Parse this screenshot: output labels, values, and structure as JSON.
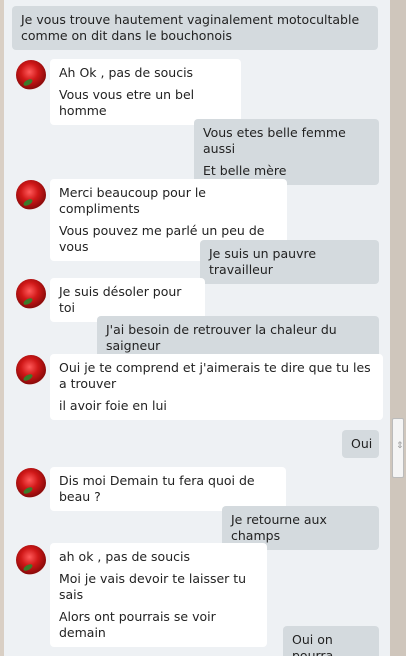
{
  "messages": [
    {
      "dir": "out",
      "lines": [
        "Je vous trouve hautement vaginalement motocultable",
        "comme on dit dans le bouchonois"
      ]
    },
    {
      "dir": "in",
      "lines": [
        "Ah Ok , pas de soucis",
        "Vous vous etre un bel homme"
      ]
    },
    {
      "dir": "out",
      "lines": [
        "Vous etes belle femme aussi",
        "Et belle mère"
      ]
    },
    {
      "dir": "in",
      "lines": [
        "Merci beaucoup pour le compliments",
        "Vous pouvez me parlé un peu de vous"
      ]
    },
    {
      "dir": "out",
      "lines": [
        "Je suis un pauvre travailleur"
      ]
    },
    {
      "dir": "in",
      "lines": [
        "Je suis désoler pour toi"
      ]
    },
    {
      "dir": "out",
      "lines": [
        "J'ai besoin de retrouver la chaleur du saigneur"
      ]
    },
    {
      "dir": "in",
      "lines": [
        "Oui je te comprend et j'aimerais te dire que tu les a trouver",
        "il avoir foie en lui"
      ]
    },
    {
      "dir": "out",
      "lines": [
        "Oui"
      ]
    },
    {
      "dir": "in",
      "lines": [
        "Dis moi Demain tu fera quoi de beau ?"
      ]
    },
    {
      "dir": "out",
      "lines": [
        "Je retourne aux champs"
      ]
    },
    {
      "dir": "in",
      "lines": [
        "ah ok , pas de soucis",
        "Moi je vais devoir te laisser tu sais",
        "Alors ont pourrais se voir demain"
      ]
    },
    {
      "dir": "out",
      "lines": [
        "Oui on pourra"
      ]
    }
  ],
  "scrollbar_icon": "grip-icon"
}
